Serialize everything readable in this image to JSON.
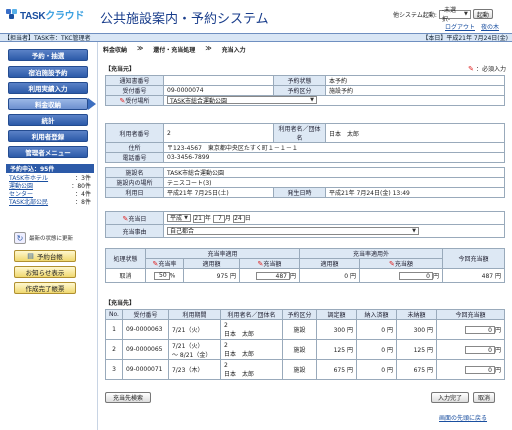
{
  "header": {
    "logo_task": "TASK",
    "logo_cloud": "クラウド",
    "app_title": "公共施設案内・予約システム",
    "system_jump_label": "他システム起動:",
    "system_jump_value": "-未選択-",
    "system_jump_button": "起動",
    "logout": "ログアウト",
    "close": "夜の木"
  },
  "infobar": {
    "left": "【担当者】TASK市：TKC管理者",
    "right": "【本日】平成21年 7月24日(金)"
  },
  "sidebar": {
    "menu": [
      "予約・抽選",
      "宿泊施設予約",
      "利用実績入力",
      "料金収納",
      "統計",
      "利用者登録",
      "管理者メニュー"
    ],
    "reservations_head": "予約申込：95件",
    "reservations": [
      {
        "name": "TASK市ホテル",
        "count": "：3件"
      },
      {
        "name": "運動公園",
        "count": "：80件"
      },
      {
        "name": "センター",
        "count": "：4件"
      },
      {
        "name": "TASK北部公民",
        "count": "：8件"
      }
    ],
    "refresh_label": "最新の状態に更新",
    "btn_ledger": "予約台帳",
    "btn_notice": "お知らせ表示",
    "btn_report": "作成完了帳票"
  },
  "main": {
    "tabs": [
      "料金収納",
      "≫",
      "還付・充当処理",
      "≫",
      "充当入力"
    ],
    "section_source": "【充当元】",
    "required_note": "：必須入力",
    "reception_no_label": "通知書番号",
    "reception_no": "",
    "state_label": "予約状態",
    "state_value": "本予約",
    "accept_no_label": "受付番号",
    "accept_no": "09-0000074",
    "category_label": "予約区分",
    "category_value": "施設予約",
    "place_label": "受付場所",
    "place_value": "TASK市総合運動公園",
    "user_no_label": "利用者番号",
    "user_no": "2",
    "user_name_label": "利用者名／団体名",
    "user_name": "日本　太郎",
    "address_label": "住所",
    "address": "〒123-4567　東京都中央区たすく町１－１－１",
    "phone_label": "電話番号",
    "phone": "03-3456-7899",
    "facility_label": "施設名",
    "facility": "TASK市総合運動公園",
    "room_label": "施設内の場所",
    "room": "テニスコート(3)",
    "use_date_label": "利用日",
    "use_date": "平成21年 7月25日(土)",
    "issue_date_label": "発生日時",
    "issue_date": "平成21年 7月24日(金) 13:49",
    "allot_date_label": "充当日",
    "allot_era": "平成",
    "allot_year": "21",
    "allot_year_unit": "年",
    "allot_month": "7",
    "allot_month_unit": "月",
    "allot_day": "24",
    "allot_day_unit": "日",
    "reason_label": "充当事由",
    "reason_value": "自己都合",
    "proc_label": "処理状態",
    "apply_head": "充当率適用",
    "except_head": "充当率適用外",
    "today_head": "今回充当額",
    "rate_label": "充当率",
    "apply_amt_label": "適用額",
    "allot_amt_label": "充当額",
    "except_apply_label": "適用額",
    "except_allot_label": "充当額",
    "proc_value": "取消",
    "rate_value": "50",
    "rate_unit": "%",
    "apply_amt": "975 円",
    "allot_amt": "487",
    "yen": "円",
    "except_apply": "0 円",
    "except_allot": "0",
    "today_amt": "487 円",
    "section_dest": "【充当先】",
    "dest_headers": [
      "No.",
      "受付番号",
      "利用期間",
      "利用者名／団体名",
      "予約区分",
      "調定額",
      "納入済額",
      "未納額",
      "今回充当額"
    ],
    "dest_rows": [
      {
        "no": "1",
        "accept": "09-0000063",
        "period": "7/21（火）",
        "period2": "",
        "uname_no": "2",
        "uname": "日本　太郎",
        "cat": "施設",
        "assess": "300 円",
        "paid": "0 円",
        "unpaid": "300 円",
        "allot": "0"
      },
      {
        "no": "2",
        "accept": "09-0000065",
        "period": "7/21（火）",
        "period2": "～ 8/21（金）",
        "uname_no": "2",
        "uname": "日本　太郎",
        "cat": "施設",
        "assess": "125 円",
        "paid": "0 円",
        "unpaid": "125 円",
        "allot": "0"
      },
      {
        "no": "3",
        "accept": "09-0000071",
        "period": "7/23（木）",
        "period2": "",
        "uname_no": "2",
        "uname": "日本　太郎",
        "cat": "施設",
        "assess": "675 円",
        "paid": "0 円",
        "unpaid": "675 円",
        "allot": "0"
      }
    ],
    "btn_search": "充当先検索",
    "btn_done": "入力完了",
    "btn_cancel": "取消",
    "to_top": "画面の先頭に戻る"
  }
}
